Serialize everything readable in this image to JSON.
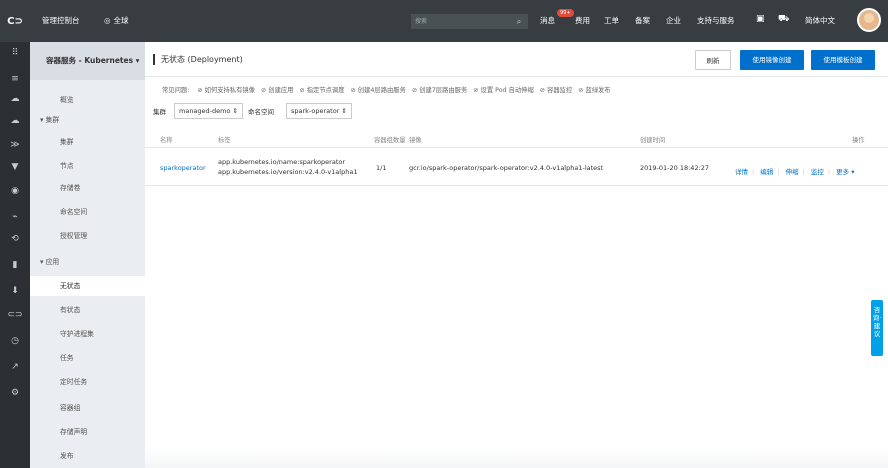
{
  "topbar": {
    "logo": "C⊃",
    "console": "管理控制台",
    "region": "全球",
    "search_placeholder": "搜索",
    "nav": [
      "消息",
      "费用",
      "工单",
      "备案",
      "企业",
      "支持与服务"
    ],
    "badge": "99+",
    "language": "简体中文"
  },
  "sidebar": {
    "service": "容器服务 - Kubernetes ▾",
    "items": [
      {
        "label": "概览",
        "type": "top"
      },
      {
        "label": "集群",
        "type": "group"
      },
      {
        "label": "集群",
        "type": "sub"
      },
      {
        "label": "节点",
        "type": "sub"
      },
      {
        "label": "存储卷",
        "type": "sub"
      },
      {
        "label": "命名空间",
        "type": "sub"
      },
      {
        "label": "授权管理",
        "type": "sub"
      },
      {
        "label": "应用",
        "type": "group"
      },
      {
        "label": "无状态",
        "type": "sub",
        "active": true
      },
      {
        "label": "有状态",
        "type": "sub"
      },
      {
        "label": "守护进程集",
        "type": "sub"
      },
      {
        "label": "任务",
        "type": "sub"
      },
      {
        "label": "定时任务",
        "type": "sub"
      },
      {
        "label": "容器组",
        "type": "sub"
      },
      {
        "label": "存储声明",
        "type": "sub"
      },
      {
        "label": "发布",
        "type": "sub"
      }
    ]
  },
  "main": {
    "title": "无状态 (Deployment)",
    "buttons": {
      "refresh": "刷新",
      "image_create": "使用镜像创建",
      "template_create": "使用模板创建"
    },
    "faq": {
      "label": "常见问题:",
      "links": [
        "如何支持私有镜像",
        "创建应用",
        "指定节点调度",
        "创建4层路由服务",
        "创建7层路由服务",
        "设置 Pod 自动伸缩",
        "容器监控",
        "蓝绿发布"
      ]
    },
    "filters": {
      "cluster_label": "集群",
      "cluster_value": "managed-demo ⇕",
      "namespace_label": "命名空间",
      "namespace_value": "spark-operator ⇕"
    },
    "table": {
      "headers": [
        "名称",
        "标签",
        "容器组数量",
        "镜像",
        "创建时间",
        "操作"
      ],
      "rows": [
        {
          "name": "sparkoperator",
          "label1": "app.kubernetes.io/name:sparkoperator",
          "label2": "app.kubernetes.io/version:v2.4.0-v1alpha1",
          "pods": "1/1",
          "image": "gcr.io/spark-operator/spark-operator:v2.4.0-v1alpha1-latest",
          "created": "2019-01-20 18:42:27",
          "ops": [
            "详情",
            "编辑",
            "伸缩",
            "监控",
            "更多 ▾"
          ]
        }
      ]
    }
  },
  "float": {
    "consult": "咨询·建议"
  }
}
